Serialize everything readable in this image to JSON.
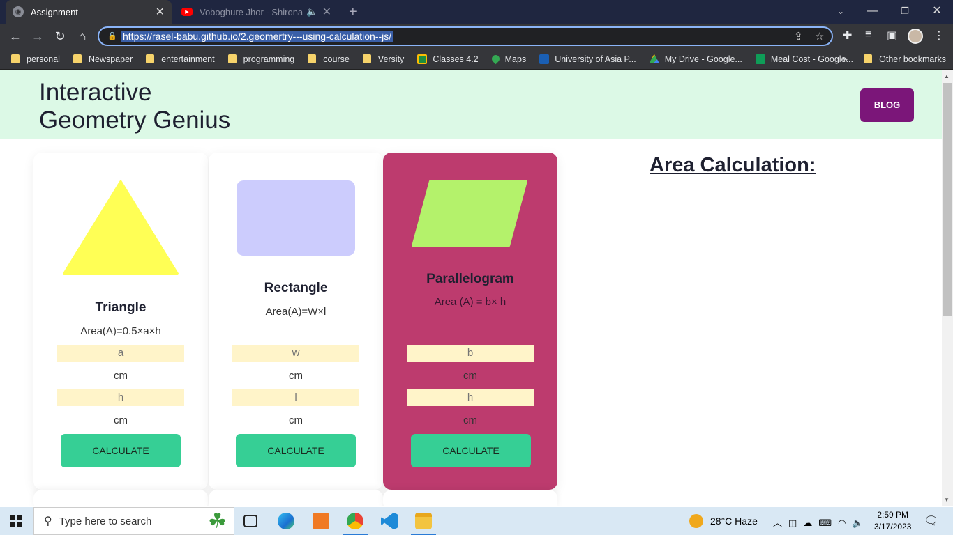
{
  "browser": {
    "tabs": [
      {
        "title": "Assignment",
        "favicon": "globe-icon",
        "active": true
      },
      {
        "title": "Voboghure Jhor - Shironamhin",
        "favicon": "youtube-icon",
        "active": false
      }
    ],
    "url": "https://rasel-babu.github.io/2.geomertry---using-calculation--js/",
    "bookmarks": [
      {
        "label": "personal",
        "icon": "folder-icon"
      },
      {
        "label": "Newspaper",
        "icon": "folder-icon"
      },
      {
        "label": "entertainment",
        "icon": "folder-icon"
      },
      {
        "label": "programming",
        "icon": "folder-icon"
      },
      {
        "label": "course",
        "icon": "folder-icon"
      },
      {
        "label": "Versity",
        "icon": "folder-icon"
      },
      {
        "label": "Classes 4.2",
        "icon": "classroom-icon"
      },
      {
        "label": "Maps",
        "icon": "maps-icon"
      },
      {
        "label": "University of Asia P...",
        "icon": "university-icon"
      },
      {
        "label": "My Drive - Google...",
        "icon": "drive-icon"
      },
      {
        "label": "Meal Cost - Google...",
        "icon": "sheets-icon"
      }
    ],
    "bookmarks_more": "»",
    "other_bookmarks": "Other bookmarks"
  },
  "header": {
    "title_line1": "Interactive",
    "title_line2": "Geometry Genius",
    "blog_label": "BLOG"
  },
  "cards": [
    {
      "name": "Triangle",
      "formula": "Area(A)=0.5×a×h",
      "input1_placeholder": "a",
      "input2_placeholder": "h",
      "unit": "cm",
      "button": "CALCULATE",
      "shape_color": "#ffff55"
    },
    {
      "name": "Rectangle",
      "formula": "Area(A)=W×l",
      "input1_placeholder": "w",
      "input2_placeholder": "l",
      "unit": "cm",
      "button": "CALCULATE",
      "shape_color": "#ccccfd"
    },
    {
      "name": "Parallelogram",
      "formula": "Area (A) = b× h",
      "input1_placeholder": "b",
      "input2_placeholder": "h",
      "unit": "cm",
      "button": "CALCULATE",
      "shape_color": "#b4f26b"
    }
  ],
  "area_section": {
    "title": "Area Calculation:"
  },
  "taskbar": {
    "search_placeholder": "Type here to search",
    "weather": "28°C  Haze",
    "time": "2:59 PM",
    "date": "3/17/2023"
  }
}
